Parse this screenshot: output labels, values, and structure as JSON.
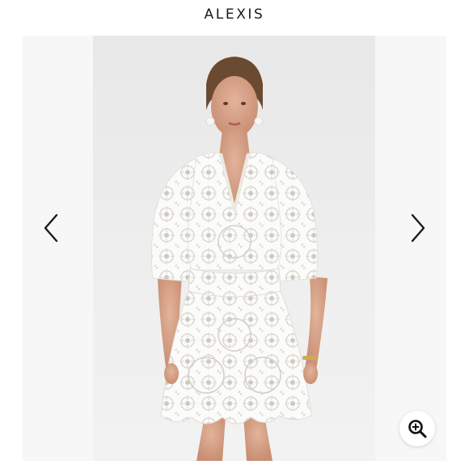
{
  "header": {
    "brand": "ALEXIS"
  },
  "gallery": {
    "image_subject": "model-in-white-lace-mini-dress",
    "icons": {
      "prev": "chevron-left-icon",
      "next": "chevron-right-icon",
      "zoom": "zoom-in-icon"
    }
  },
  "colors": {
    "text": "#1a1a1a",
    "gallery_bg": "#f7f7f7",
    "dress": "#fbfbf9",
    "skin": "#d9a48c",
    "hair": "#6b4a32"
  }
}
